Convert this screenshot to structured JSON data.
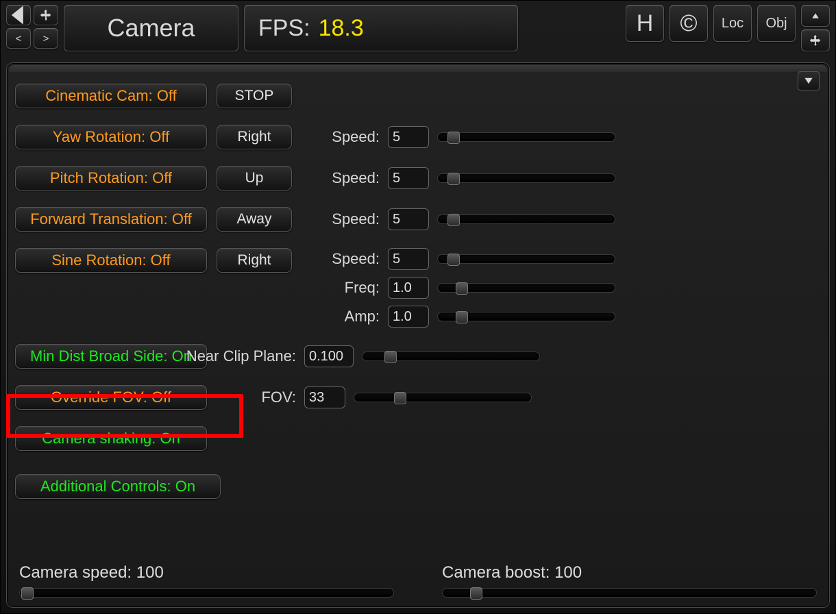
{
  "header": {
    "title": "Camera",
    "fps_label": "FPS:",
    "fps_value": "18.3",
    "h_btn": "H",
    "c_btn": "©",
    "loc_btn": "Loc",
    "obj_btn": "Obj",
    "back": "◄",
    "lt": "<",
    "gt": ">"
  },
  "rows": {
    "cinematic": {
      "label": "Cinematic Cam: Off",
      "aux": "STOP"
    },
    "yaw": {
      "label": "Yaw Rotation: Off",
      "aux": "Right",
      "speed_label": "Speed:",
      "speed_val": "5"
    },
    "pitch": {
      "label": "Pitch Rotation: Off",
      "aux": "Up",
      "speed_label": "Speed:",
      "speed_val": "5"
    },
    "forward": {
      "label": "Forward Translation: Off",
      "aux": "Away",
      "speed_label": "Speed:",
      "speed_val": "5"
    },
    "sine": {
      "label": "Sine Rotation: Off",
      "aux": "Right",
      "speed_label": "Speed:",
      "speed_val": "5",
      "freq_label": "Freq:",
      "freq_val": "1.0",
      "amp_label": "Amp:",
      "amp_val": "1.0"
    },
    "mindist": {
      "label": "Min Dist Broad Side: On",
      "near_label": "Near Clip Plane:",
      "near_val": "0.100"
    },
    "fov": {
      "label": "Override FOV: Off",
      "fov_label": "FOV:",
      "fov_val": "33"
    },
    "shaking": {
      "label": "Camera shaking: On"
    },
    "additional": {
      "label": "Additional Controls: On"
    }
  },
  "bottom": {
    "speed_label": "Camera speed: 100",
    "boost_label": "Camera boost: 100"
  }
}
